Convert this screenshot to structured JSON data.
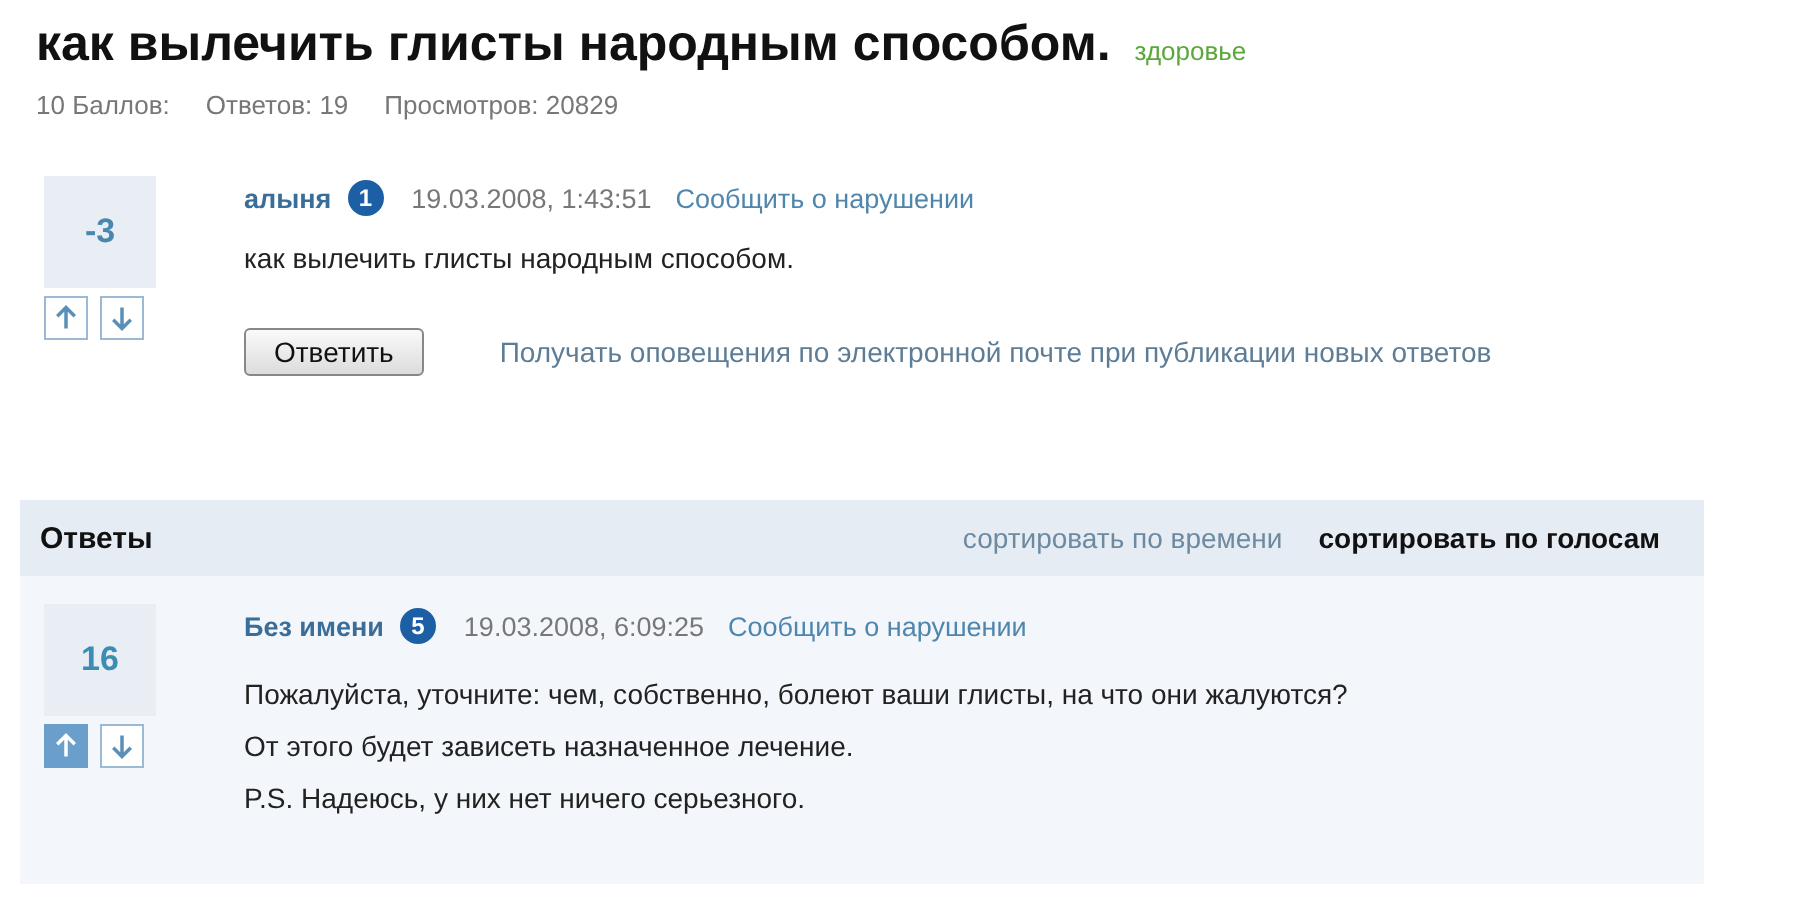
{
  "question": {
    "title": "как вылечить глисты народным способом.",
    "category": "здоровье",
    "stats": [
      {
        "label": "10 Баллов:"
      },
      {
        "label": "Ответов: 19"
      },
      {
        "label": "Просмотров: 20829"
      }
    ],
    "score": "-3",
    "voted_up": false,
    "voted_down": false,
    "author": "алыня",
    "rank": "1",
    "date": "19.03.2008, 1:43:51",
    "report": "Сообщить о нарушении",
    "text": [
      "как вылечить глисты народным способом."
    ],
    "reply_button": "Ответить",
    "notify_link": "Получать оповещения по электронной почте при публикации новых ответов"
  },
  "answers": {
    "title": "Ответы",
    "sort": [
      {
        "label": "сортировать по времени",
        "selected": false
      },
      {
        "label": "сортировать по голосам",
        "selected": true
      }
    ],
    "items": [
      {
        "score": "16",
        "voted_up": true,
        "voted_down": false,
        "author": "Без имени",
        "rank": "5",
        "date": "19.03.2008, 6:09:25",
        "report": "Сообщить о нарушении",
        "text": [
          "Пожалуйста, уточните: чем, собственно, болеют ваши глисты, на что они жалуются?",
          "От этого будет зависеть назначенное лечение.",
          "P.S. Надеюсь, у них нет ничего серьезного."
        ]
      }
    ]
  }
}
